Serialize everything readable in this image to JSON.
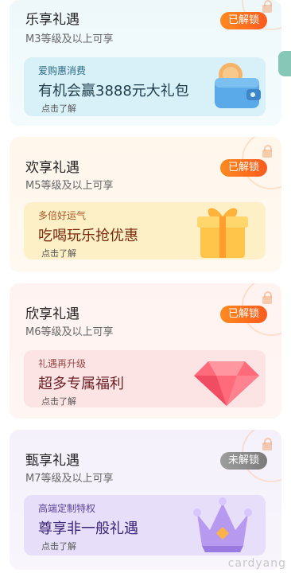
{
  "cards": [
    {
      "title": "乐享礼遇",
      "subtitle": "M3等级及以上可享",
      "badge": "已解锁",
      "promo": {
        "small": "爱购惠消费",
        "big": "有机会赢3888元大礼包",
        "link": "点击了解"
      },
      "icon": "wallet-icon"
    },
    {
      "title": "欢享礼遇",
      "subtitle": "M5等级及以上可享",
      "badge": "已解锁",
      "promo": {
        "small": "多倍好运气",
        "big": "吃喝玩乐抢优惠",
        "link": "点击了解"
      },
      "icon": "gift-box-icon"
    },
    {
      "title": "欣享礼遇",
      "subtitle": "M6等级及以上可享",
      "badge": "已解锁",
      "promo": {
        "small": "礼遇再升级",
        "big": "超多专属福利",
        "link": "点击了解"
      },
      "icon": "diamond-icon"
    },
    {
      "title": "甄享礼遇",
      "subtitle": "M7等级及以上可享",
      "badge": "未解锁",
      "promo": {
        "small": "高端定制特权",
        "big": "尊享非一般礼遇",
        "link": "点击了解"
      },
      "icon": "crown-icon"
    }
  ],
  "watermark": "cardyang",
  "side_avatar": "avatar-icon"
}
